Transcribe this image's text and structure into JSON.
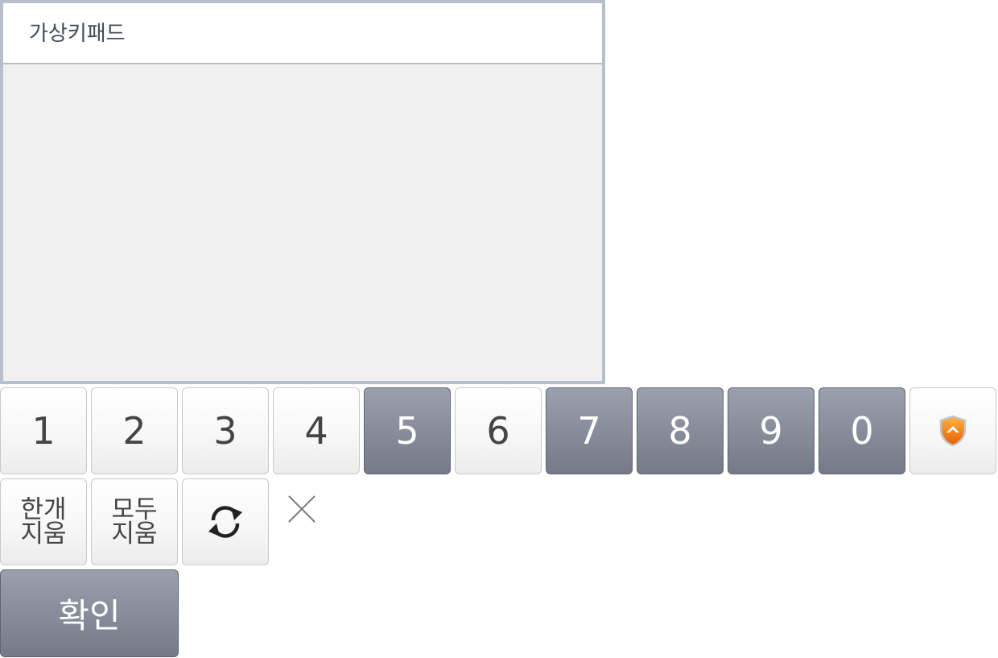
{
  "keypad": {
    "title": "가상키패드",
    "number_keys": [
      {
        "label": "1",
        "style": "light"
      },
      {
        "label": "2",
        "style": "light"
      },
      {
        "label": "3",
        "style": "light"
      },
      {
        "label": "4",
        "style": "light"
      },
      {
        "label": "5",
        "style": "dark"
      },
      {
        "label": "6",
        "style": "light"
      },
      {
        "label": "7",
        "style": "dark"
      },
      {
        "label": "8",
        "style": "dark"
      },
      {
        "label": "9",
        "style": "dark"
      },
      {
        "label": "0",
        "style": "dark"
      }
    ],
    "backspace_label": "한개\n지움",
    "clear_all_label": "모두\n지움",
    "refresh_icon": "refresh-icon",
    "shield_icon": "shield-icon",
    "close_icon": "close-icon",
    "confirm_label": "확인"
  },
  "colors": {
    "border": "#b7bfcc",
    "dark_key": "#858b99",
    "light_key": "#f7f7f7",
    "shield_orange": "#f07d1a"
  }
}
